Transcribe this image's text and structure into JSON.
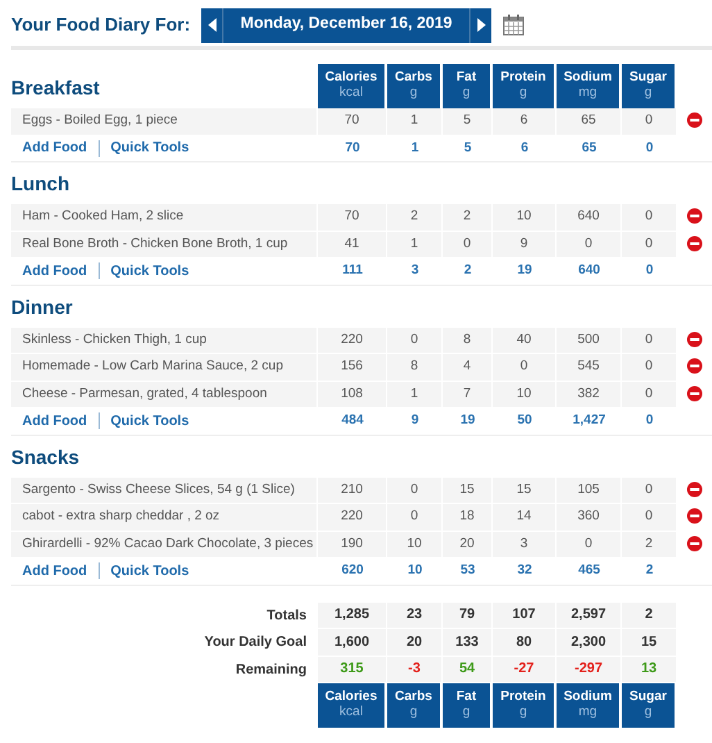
{
  "header": {
    "label": "Your Food Diary For:",
    "date": "Monday, December 16, 2019"
  },
  "columns": [
    {
      "name": "Calories",
      "unit": "kcal"
    },
    {
      "name": "Carbs",
      "unit": "g"
    },
    {
      "name": "Fat",
      "unit": "g"
    },
    {
      "name": "Protein",
      "unit": "g"
    },
    {
      "name": "Sodium",
      "unit": "mg"
    },
    {
      "name": "Sugar",
      "unit": "g"
    }
  ],
  "meals": [
    {
      "name": "Breakfast",
      "entries": [
        {
          "food": "Eggs - Boiled Egg, 1 piece",
          "values": [
            "70",
            "1",
            "5",
            "6",
            "65",
            "0"
          ]
        }
      ],
      "add_food": "Add Food",
      "quick_tools": "Quick Tools",
      "totals": [
        "70",
        "1",
        "5",
        "6",
        "65",
        "0"
      ]
    },
    {
      "name": "Lunch",
      "entries": [
        {
          "food": "Ham - Cooked Ham, 2 slice",
          "values": [
            "70",
            "2",
            "2",
            "10",
            "640",
            "0"
          ]
        },
        {
          "food": "Real Bone Broth - Chicken Bone Broth, 1 cup",
          "values": [
            "41",
            "1",
            "0",
            "9",
            "0",
            "0"
          ]
        }
      ],
      "add_food": "Add Food",
      "quick_tools": "Quick Tools",
      "totals": [
        "111",
        "3",
        "2",
        "19",
        "640",
        "0"
      ]
    },
    {
      "name": "Dinner",
      "entries": [
        {
          "food": "Skinless - Chicken Thigh, 1 cup",
          "values": [
            "220",
            "0",
            "8",
            "40",
            "500",
            "0"
          ]
        },
        {
          "food": "Homemade - Low Carb Marina Sauce, 2 cup",
          "values": [
            "156",
            "8",
            "4",
            "0",
            "545",
            "0"
          ]
        },
        {
          "food": "Cheese - Parmesan, grated, 4 tablespoon",
          "values": [
            "108",
            "1",
            "7",
            "10",
            "382",
            "0"
          ]
        }
      ],
      "add_food": "Add Food",
      "quick_tools": "Quick Tools",
      "totals": [
        "484",
        "9",
        "19",
        "50",
        "1,427",
        "0"
      ]
    },
    {
      "name": "Snacks",
      "entries": [
        {
          "food": "Sargento - Swiss Cheese Slices, 54 g (1 Slice)",
          "values": [
            "210",
            "0",
            "15",
            "15",
            "105",
            "0"
          ]
        },
        {
          "food": "cabot - extra sharp cheddar , 2 oz",
          "values": [
            "220",
            "0",
            "18",
            "14",
            "360",
            "0"
          ]
        },
        {
          "food": "Ghirardelli - 92% Cacao Dark Chocolate, 3 pieces",
          "values": [
            "190",
            "10",
            "20",
            "3",
            "0",
            "2"
          ]
        }
      ],
      "add_food": "Add Food",
      "quick_tools": "Quick Tools",
      "totals": [
        "620",
        "10",
        "53",
        "32",
        "465",
        "2"
      ]
    }
  ],
  "summary": [
    {
      "label": "Totals",
      "values": [
        {
          "text": "1,285"
        },
        {
          "text": "23"
        },
        {
          "text": "79"
        },
        {
          "text": "107"
        },
        {
          "text": "2,597"
        },
        {
          "text": "2"
        }
      ]
    },
    {
      "label": "Your Daily Goal",
      "values": [
        {
          "text": "1,600"
        },
        {
          "text": "20"
        },
        {
          "text": "133"
        },
        {
          "text": "80"
        },
        {
          "text": "2,300"
        },
        {
          "text": "15"
        }
      ]
    },
    {
      "label": "Remaining",
      "values": [
        {
          "text": "315",
          "over": false
        },
        {
          "text": "-3",
          "over": true
        },
        {
          "text": "54",
          "over": false
        },
        {
          "text": "-27",
          "over": true
        },
        {
          "text": "-297",
          "over": true
        },
        {
          "text": "13",
          "over": false
        }
      ]
    }
  ],
  "footer_columns": [
    {
      "name": "Calories",
      "unit": "kcal"
    },
    {
      "name": "Carbs",
      "unit": "g"
    },
    {
      "name": "Fat",
      "unit": "g"
    },
    {
      "name": "Protein",
      "unit": "g"
    },
    {
      "name": "Sodium",
      "unit": "mg"
    },
    {
      "name": "Sugar",
      "unit": "g"
    }
  ]
}
